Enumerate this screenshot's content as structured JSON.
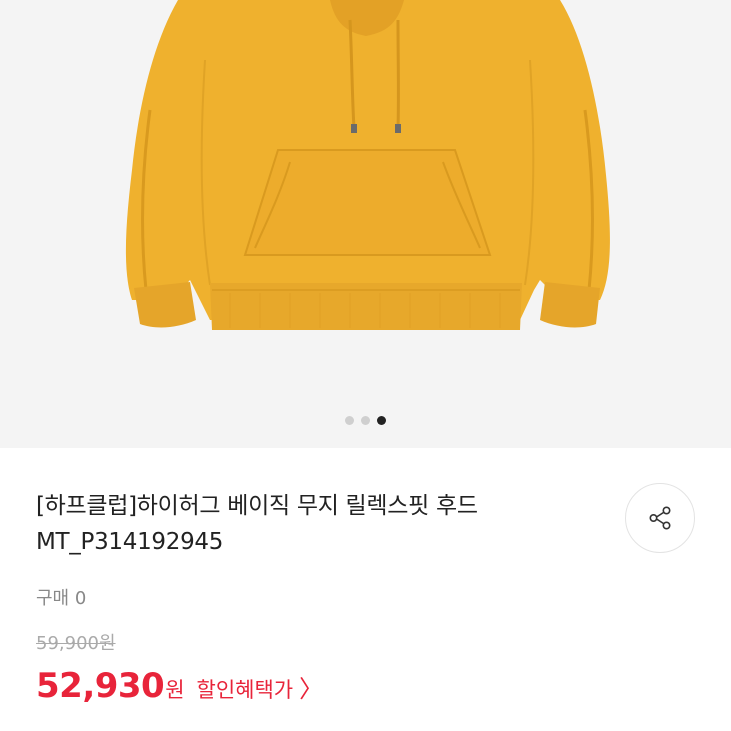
{
  "gallery": {
    "product_image": "yellow-hoodie",
    "dots": [
      {
        "active": false
      },
      {
        "active": false
      },
      {
        "active": true
      }
    ]
  },
  "product": {
    "title_line1": "[하프클럽]하이허그 베이직 무지 릴렉스핏 후드",
    "title_line2": "MT_P314192945",
    "purchase_count": "구매 0",
    "original_price": "59,900원",
    "sale_price": "52,930",
    "sale_unit": "원",
    "benefit_label": "할인혜택가",
    "benefit_chevron": "〉"
  },
  "share": {
    "icon": "share-icon"
  },
  "colors": {
    "accent": "#e8243a",
    "hoodie": "#EFB12E"
  }
}
